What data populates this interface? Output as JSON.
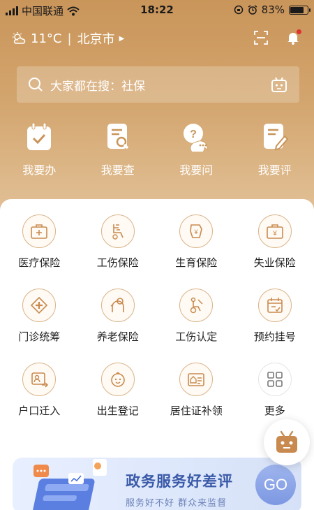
{
  "status_bar": {
    "carrier": "中国联通",
    "time": "18:22",
    "battery": "83%",
    "battery_level": 0.83
  },
  "header": {
    "temperature": "11°C",
    "city": "北京市"
  },
  "search": {
    "placeholder": "大家都在搜：社保"
  },
  "quick_actions": [
    {
      "label": "我要办",
      "icon": "calendar-check-icon"
    },
    {
      "label": "我要查",
      "icon": "document-search-icon"
    },
    {
      "label": "我要问",
      "icon": "question-chat-icon"
    },
    {
      "label": "我要评",
      "icon": "document-edit-icon"
    }
  ],
  "services": [
    {
      "label": "医疗保险",
      "icon": "medical-kit-icon"
    },
    {
      "label": "工伤保险",
      "icon": "wheelchair-icon"
    },
    {
      "label": "生育保险",
      "icon": "maternity-icon"
    },
    {
      "label": "失业保险",
      "icon": "briefcase-yuan-icon"
    },
    {
      "label": "门诊统筹",
      "icon": "clinic-cross-icon"
    },
    {
      "label": "养老保险",
      "icon": "elderly-icon"
    },
    {
      "label": "工伤认定",
      "icon": "injury-certify-icon"
    },
    {
      "label": "预约挂号",
      "icon": "appointment-icon"
    },
    {
      "label": "户口迁入",
      "icon": "household-move-icon"
    },
    {
      "label": "出生登记",
      "icon": "baby-icon"
    },
    {
      "label": "居住证补领",
      "icon": "residence-card-icon"
    },
    {
      "label": "更多",
      "icon": "grid-more-icon"
    }
  ],
  "banner": {
    "title": "政务服务好差评",
    "subtitle": "服务好不好 群众来监督",
    "button": "GO"
  },
  "colors": {
    "hero_gold": "#c9955a",
    "icon_accent": "#c88a4e",
    "banner_blue": "#3a5aa8"
  }
}
